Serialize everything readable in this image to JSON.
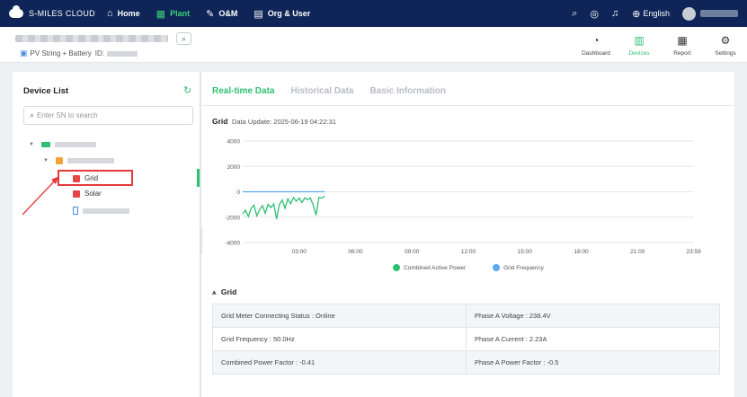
{
  "nav": {
    "logo": "S-MILES CLOUD",
    "items": [
      {
        "label": "Home",
        "icon": "home-icon"
      },
      {
        "label": "Plant",
        "icon": "plant-icon",
        "active": true
      },
      {
        "label": "O&M",
        "icon": "wrench-icon"
      },
      {
        "label": "Org & User",
        "icon": "document-icon"
      }
    ],
    "language": "English"
  },
  "subheader": {
    "plant_type": "PV String + Battery",
    "id_label": "ID:",
    "tabs": [
      {
        "label": "Dashboard",
        "icon": "gauge-icon"
      },
      {
        "label": "Devices",
        "icon": "devices-icon",
        "active": true
      },
      {
        "label": "Report",
        "icon": "calendar-icon"
      },
      {
        "label": "Settings",
        "icon": "gear-icon"
      }
    ]
  },
  "device_list": {
    "title": "Device List",
    "search_placeholder": "Enter SN to search",
    "devices": [
      {
        "label": "Grid",
        "selected": true
      },
      {
        "label": "Solar"
      }
    ]
  },
  "detail": {
    "tabs": [
      "Real-time Data",
      "Historical Data",
      "Basic Information"
    ],
    "active_tab": "Real-time Data",
    "grid_label": "Grid",
    "data_update": "Data Update: 2025-06-19 04:22:31",
    "section_title": "Grid",
    "rows": [
      [
        "Grid Meter Connecting Status : Online",
        "Phase A Voltage : 238.4V"
      ],
      [
        "Grid Frequency : 50.0Hz",
        "Phase A Current : 2.23A"
      ],
      [
        "Combined Power Factor : -0.41",
        "Phase A Power Factor : -0.5"
      ]
    ]
  },
  "chart_data": {
    "type": "line",
    "y_ticks": [
      "4000",
      "2000",
      "0",
      "-2000",
      "-4000"
    ],
    "x_ticks": [
      "03:00",
      "06:00",
      "09:00",
      "12:00",
      "15:00",
      "18:00",
      "21:00",
      "23:59"
    ],
    "ylim": [
      -4000,
      4000
    ],
    "xlim": [
      0,
      24
    ],
    "grid": true,
    "legend_position": "bottom",
    "series": [
      {
        "name": "Combined Active Power",
        "color": "#2fbf71",
        "points": [
          [
            0.0,
            -1750
          ],
          [
            0.15,
            -1450
          ],
          [
            0.3,
            -1950
          ],
          [
            0.45,
            -1300
          ],
          [
            0.6,
            -1050
          ],
          [
            0.75,
            -1900
          ],
          [
            0.9,
            -1400
          ],
          [
            1.05,
            -1100
          ],
          [
            1.2,
            -1700
          ],
          [
            1.35,
            -1000
          ],
          [
            1.5,
            -1250
          ],
          [
            1.65,
            -950
          ],
          [
            1.8,
            -2150
          ],
          [
            1.95,
            -1000
          ],
          [
            2.1,
            -650
          ],
          [
            2.25,
            -1300
          ],
          [
            2.4,
            -550
          ],
          [
            2.55,
            -950
          ],
          [
            2.7,
            -450
          ],
          [
            2.85,
            -750
          ],
          [
            3.0,
            -500
          ],
          [
            3.15,
            -850
          ],
          [
            3.3,
            -480
          ],
          [
            3.45,
            -620
          ],
          [
            3.6,
            -500
          ],
          [
            3.75,
            -1050
          ],
          [
            3.9,
            -1850
          ],
          [
            4.05,
            -450
          ],
          [
            4.2,
            -500
          ],
          [
            4.35,
            -350
          ]
        ]
      },
      {
        "name": "Grid Frequency",
        "color": "#5ba7f0",
        "points": [
          [
            0.0,
            0
          ],
          [
            4.35,
            0
          ]
        ]
      }
    ]
  }
}
